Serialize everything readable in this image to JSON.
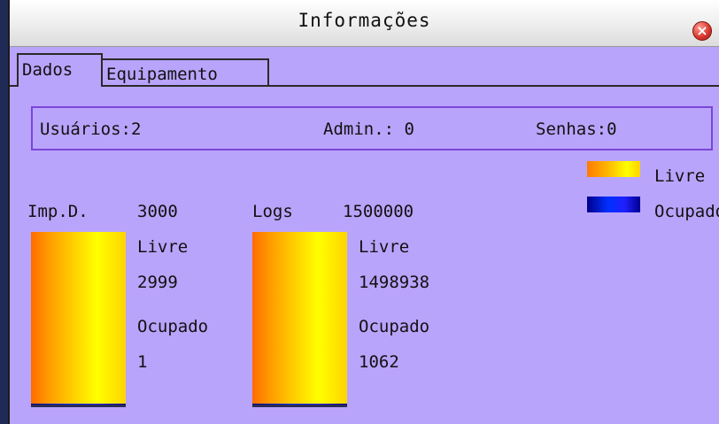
{
  "window": {
    "title": "Informações",
    "close_glyph": "×"
  },
  "tabs": [
    {
      "label": "Dados",
      "active": true
    },
    {
      "label": "Equipamento",
      "active": false
    }
  ],
  "stats": {
    "users": "Usuários:2",
    "admin": "Admin.: 0",
    "passwords": "Senhas:0"
  },
  "legend": {
    "free_label": "Livre",
    "used_label": "Ocupado",
    "free_color": "#ffd000",
    "used_color": "#0030ff"
  },
  "fingerprints": {
    "title": "Imp.D.",
    "total": "3000",
    "free_label": "Livre",
    "free": "2999",
    "used_label": "Ocupado",
    "used": "1",
    "used_fraction": 0.00033
  },
  "logs": {
    "title": "Logs",
    "total": "1500000",
    "free_label": "Livre",
    "free": "1498938",
    "used_label": "Ocupado",
    "used": "1062",
    "used_fraction": 0.00071
  }
}
